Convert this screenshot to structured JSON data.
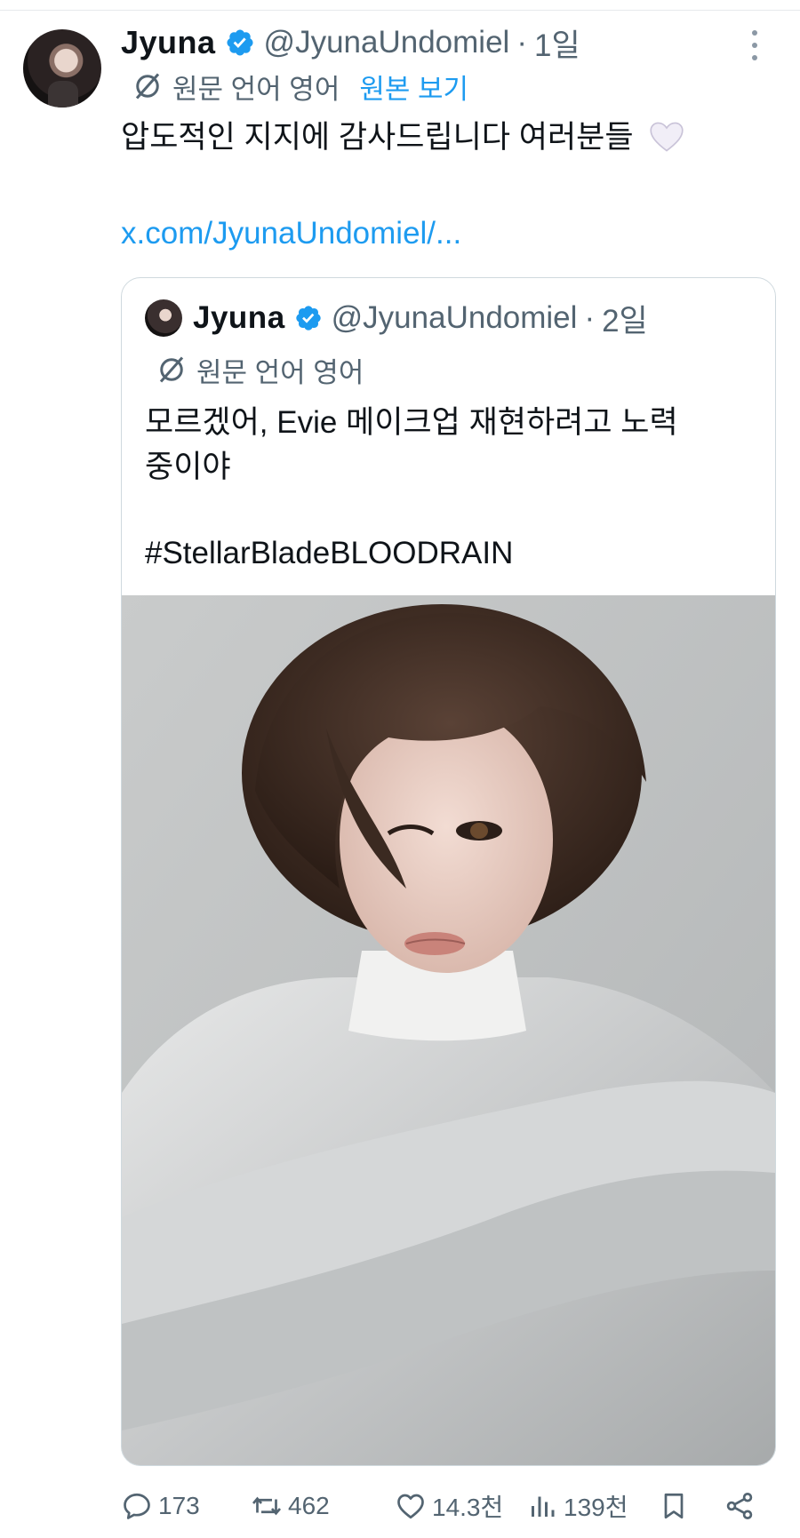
{
  "tweet": {
    "author_name": "Jyuna",
    "handle": "@JyunaUndomiel",
    "separator": "·",
    "time": "1일",
    "translation_note": "원문 언어 영어",
    "show_original": "원본 보기",
    "text": "압도적인 지지에 감사드립니다 여러분들",
    "link": "x.com/JyunaUndomiel/..."
  },
  "quoted_tweet": {
    "author_name": "Jyuna",
    "handle": "@JyunaUndomiel",
    "separator": "·",
    "time": "2일",
    "translation_note": "원문 언어 영어",
    "text_line1": "모르겠어, Evie 메이크업 재현하려고 노력",
    "text_line2": "중이야",
    "hashtag": "#StellarBladeBLOODRAIN"
  },
  "actions": {
    "replies": "173",
    "reposts": "462",
    "likes": "14.3천",
    "views": "139천"
  },
  "icons": {
    "verified": "verified-badge-icon",
    "translate": "translate-icon",
    "more": "more-icon",
    "reply": "reply-icon",
    "repost": "repost-icon",
    "like": "like-icon",
    "views": "views-icon",
    "bookmark": "bookmark-icon",
    "share": "share-icon",
    "emoji": "white-heart-emoji"
  },
  "colors": {
    "accent": "#1d9bf0",
    "secondary_text": "#536471",
    "primary_text": "#0f1419",
    "border": "#cfd9de"
  }
}
